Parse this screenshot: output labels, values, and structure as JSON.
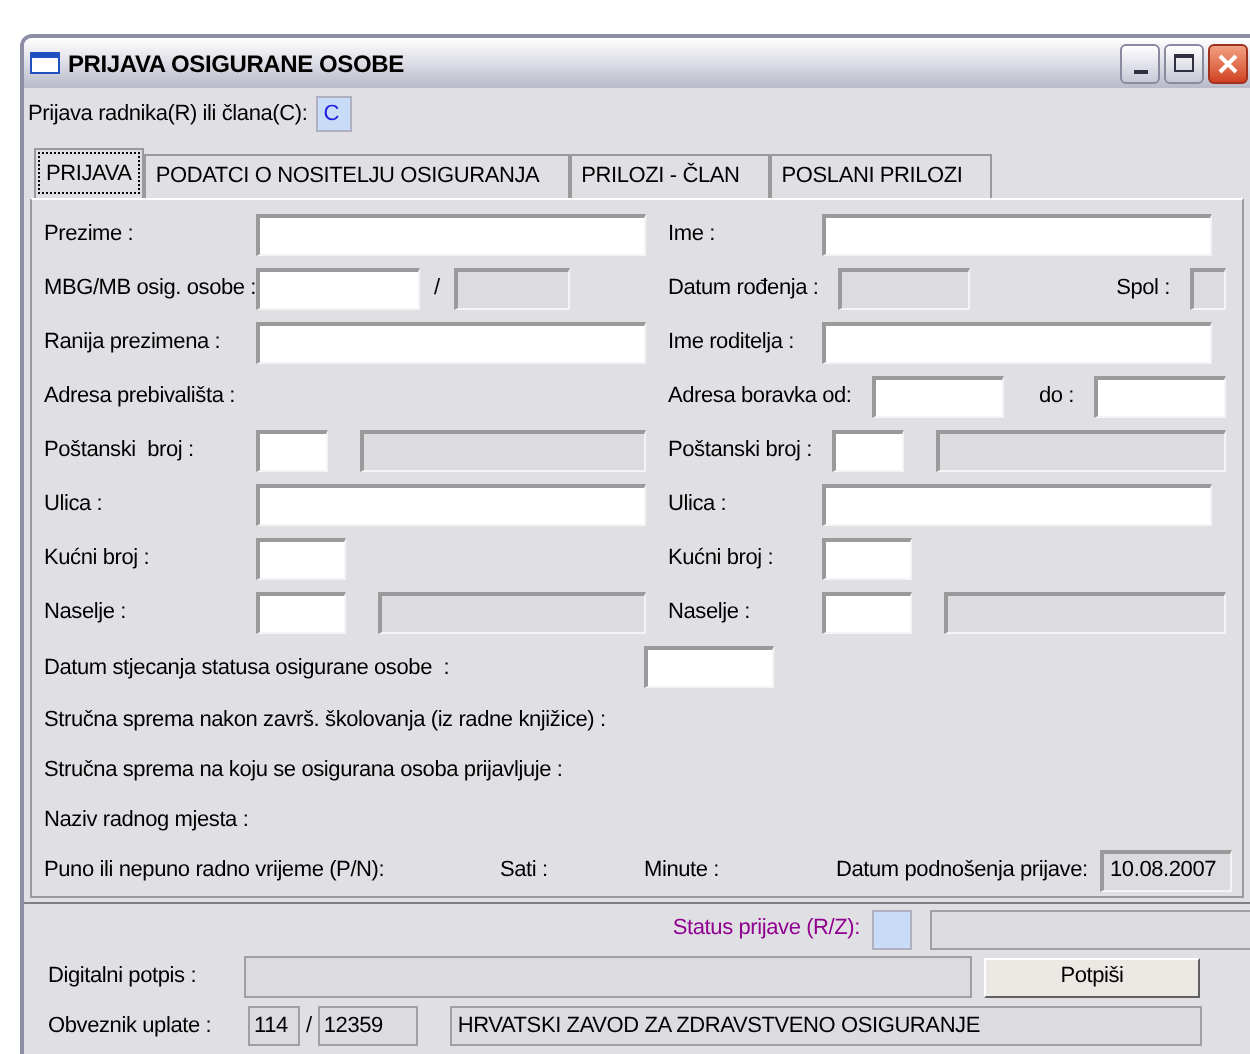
{
  "window": {
    "title": "PRIJAVA OSIGURANE OSOBE"
  },
  "prijava_type": {
    "label": "Prijava radnika(R) ili člana(C):",
    "value": "C"
  },
  "tabs": [
    {
      "label": "PRIJAVA",
      "selected": true
    },
    {
      "label": "PODATCI O NOSITELJU OSIGURANJA",
      "selected": false
    },
    {
      "label": "PRILOZI - ČLAN",
      "selected": false
    },
    {
      "label": "POSLANI PRILOZI",
      "selected": false
    }
  ],
  "rows": [
    {
      "left": {
        "label": "Prezime :",
        "items": [
          {
            "kind": "wide",
            "disabled": false
          }
        ]
      },
      "right": {
        "label": "Ime :",
        "items": [
          {
            "kind": "wide",
            "disabled": false
          }
        ]
      }
    },
    {
      "left": {
        "label": "MBG/MB osig. osobe :",
        "items": [
          {
            "kind": "code",
            "disabled": false
          },
          {
            "kind": "text",
            "text": "/"
          },
          {
            "kind": "medium",
            "disabled": true
          }
        ]
      },
      "right": {
        "label": "Datum rođenja :",
        "items": [
          {
            "kind": "date",
            "disabled": true
          },
          {
            "kind": "push_text",
            "text": "Spol :"
          },
          {
            "kind": "tiny",
            "disabled": true
          }
        ]
      }
    },
    {
      "left": {
        "label": "Ranija prezimena :",
        "items": [
          {
            "kind": "wide",
            "disabled": false
          }
        ]
      },
      "right": {
        "label": "Ime roditelja :",
        "items": [
          {
            "kind": "wide",
            "disabled": false
          }
        ]
      }
    },
    {
      "left": {
        "label": "Adresa prebivališta :"
      },
      "right": {
        "label": "Adresa boravka od:",
        "items": [
          {
            "kind": "date",
            "disabled": false
          },
          {
            "kind": "push_text",
            "text": "do :"
          },
          {
            "kind": "date",
            "disabled": false
          }
        ]
      }
    },
    {
      "left": {
        "label": "Poštanski  broj :",
        "items": [
          {
            "kind": "short",
            "disabled": false
          },
          {
            "kind": "fill",
            "disabled": true
          }
        ]
      },
      "right": {
        "label": "Poštanski broj :",
        "items": [
          {
            "kind": "short",
            "disabled": false
          },
          {
            "kind": "fill",
            "disabled": true
          }
        ]
      }
    },
    {
      "left": {
        "label": "Ulica :",
        "items": [
          {
            "kind": "wide",
            "disabled": false
          }
        ]
      },
      "right": {
        "label": "Ulica :",
        "items": [
          {
            "kind": "wide",
            "disabled": false
          }
        ]
      }
    },
    {
      "left": {
        "label": "Kućni broj :",
        "items": [
          {
            "kind": "house",
            "disabled": false
          }
        ]
      },
      "right": {
        "label": "Kućni broj :",
        "items": [
          {
            "kind": "house",
            "disabled": false
          }
        ]
      }
    },
    {
      "left": {
        "label": "Naselje :",
        "items": [
          {
            "kind": "house",
            "disabled": false
          },
          {
            "kind": "fill",
            "disabled": true
          }
        ]
      },
      "right": {
        "label": "Naselje :",
        "items": [
          {
            "kind": "house",
            "disabled": false
          },
          {
            "kind": "fill",
            "disabled": true
          }
        ]
      }
    }
  ],
  "datum_stjecanja": {
    "label": "Datum stjecanja statusa osigurane osobe  :"
  },
  "info_lines": [
    "Stručna sprema nakon završ. školovanja (iz radne knjižice) :",
    "Stručna sprema na koju se osigurana osoba prijavljuje :",
    "Naziv radnog mjesta :"
  ],
  "work_time": {
    "label": "Puno ili nepuno radno vrijeme (P/N):",
    "hours": "Sati :",
    "minutes": "Minute :",
    "submit_date_label": "Datum podnošenja prijave:",
    "submit_date": "10.08.2007"
  },
  "status": {
    "label": "Status prijave (R/Z):"
  },
  "signature": {
    "label": "Digitalni potpis :",
    "button": "Potpiši"
  },
  "payer": {
    "label": "Obveznik uplate :",
    "code_1": "114",
    "separator": "/",
    "code_2": "12359",
    "name": "HRVATSKI ZAVOD ZA ZDRAVSTVENO OSIGURANJE"
  }
}
